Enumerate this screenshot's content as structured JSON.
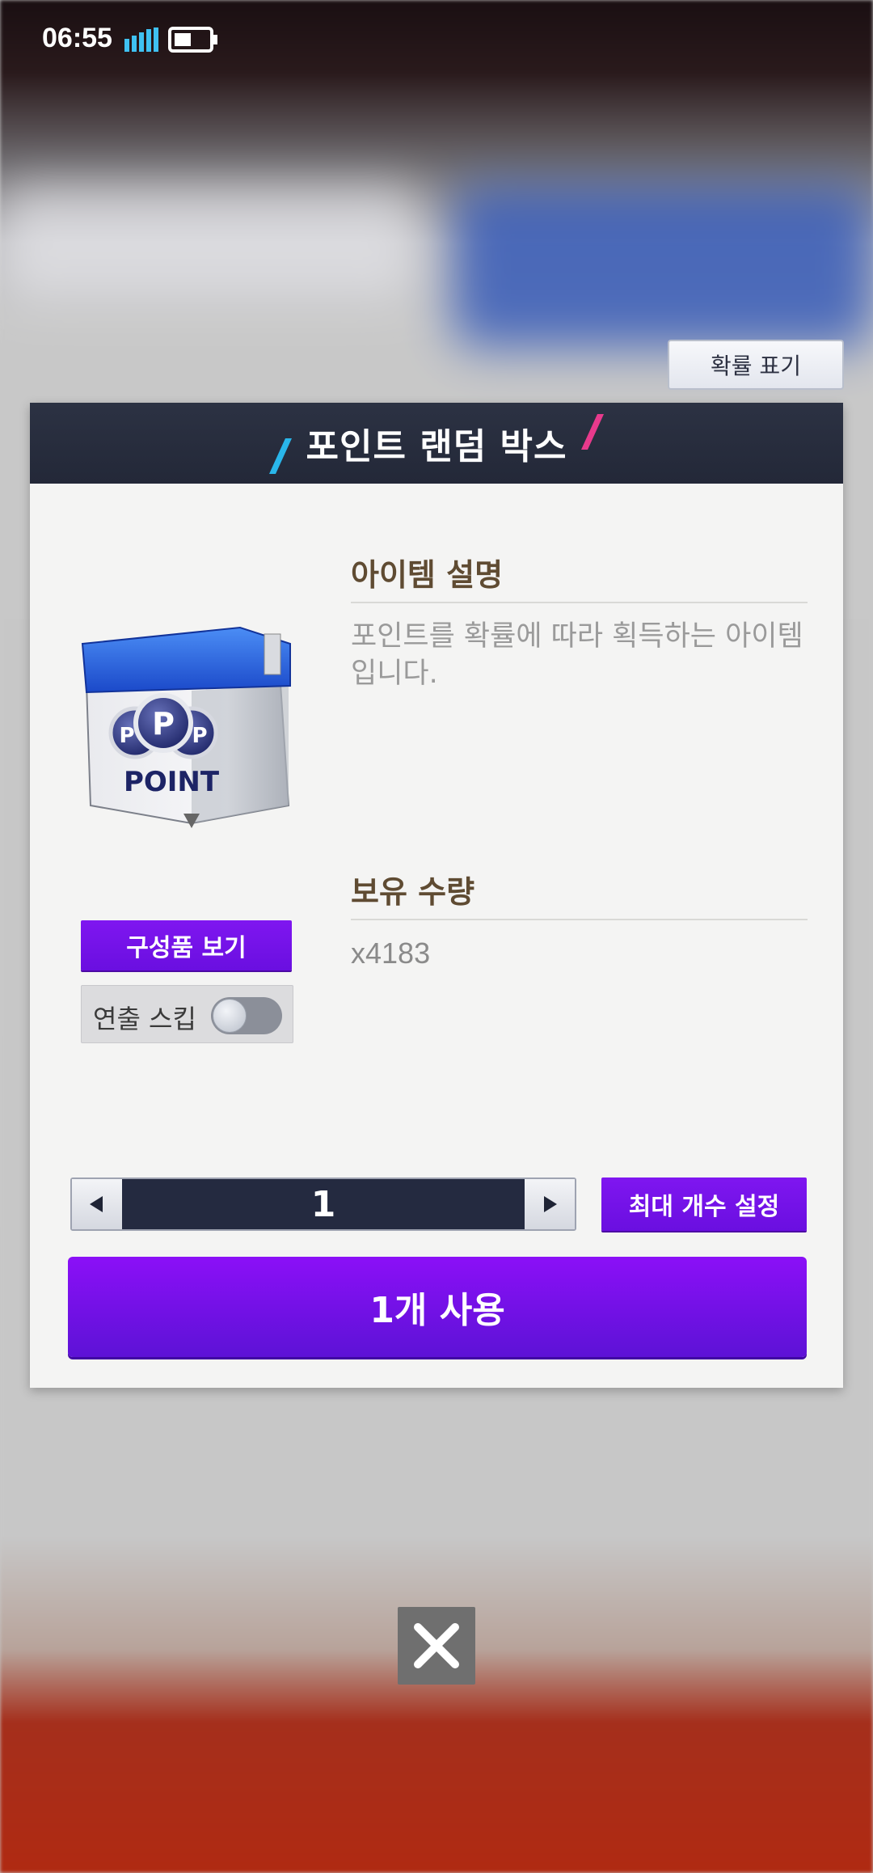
{
  "status_bar": {
    "time": "06:55"
  },
  "probability_button": {
    "label": "확률 표기"
  },
  "dialog": {
    "title": "포인트 랜덤 박스",
    "item_image_text": "POINT",
    "description_title": "아이템 설명",
    "description_text": "포인트를 확률에 따라 획득하는 아이템입니다.",
    "quantity_title": "보유 수량",
    "quantity_value": "x4183",
    "components_button": "구성품 보기",
    "skip_label": "연출 스킵",
    "skip_enabled": false,
    "stepper_value": "1",
    "max_button": "최대 개수 설정",
    "use_button": "1개 사용"
  },
  "colors": {
    "accent_purple": "#7f16f0",
    "header_navy": "#2c3243",
    "slash_blue": "#29b6ea",
    "slash_pink": "#e83a8c"
  },
  "icons": {
    "signal": "signal-icon",
    "battery": "battery-icon",
    "left_arrow": "triangle-left-icon",
    "right_arrow": "triangle-right-icon",
    "close": "close-icon"
  }
}
